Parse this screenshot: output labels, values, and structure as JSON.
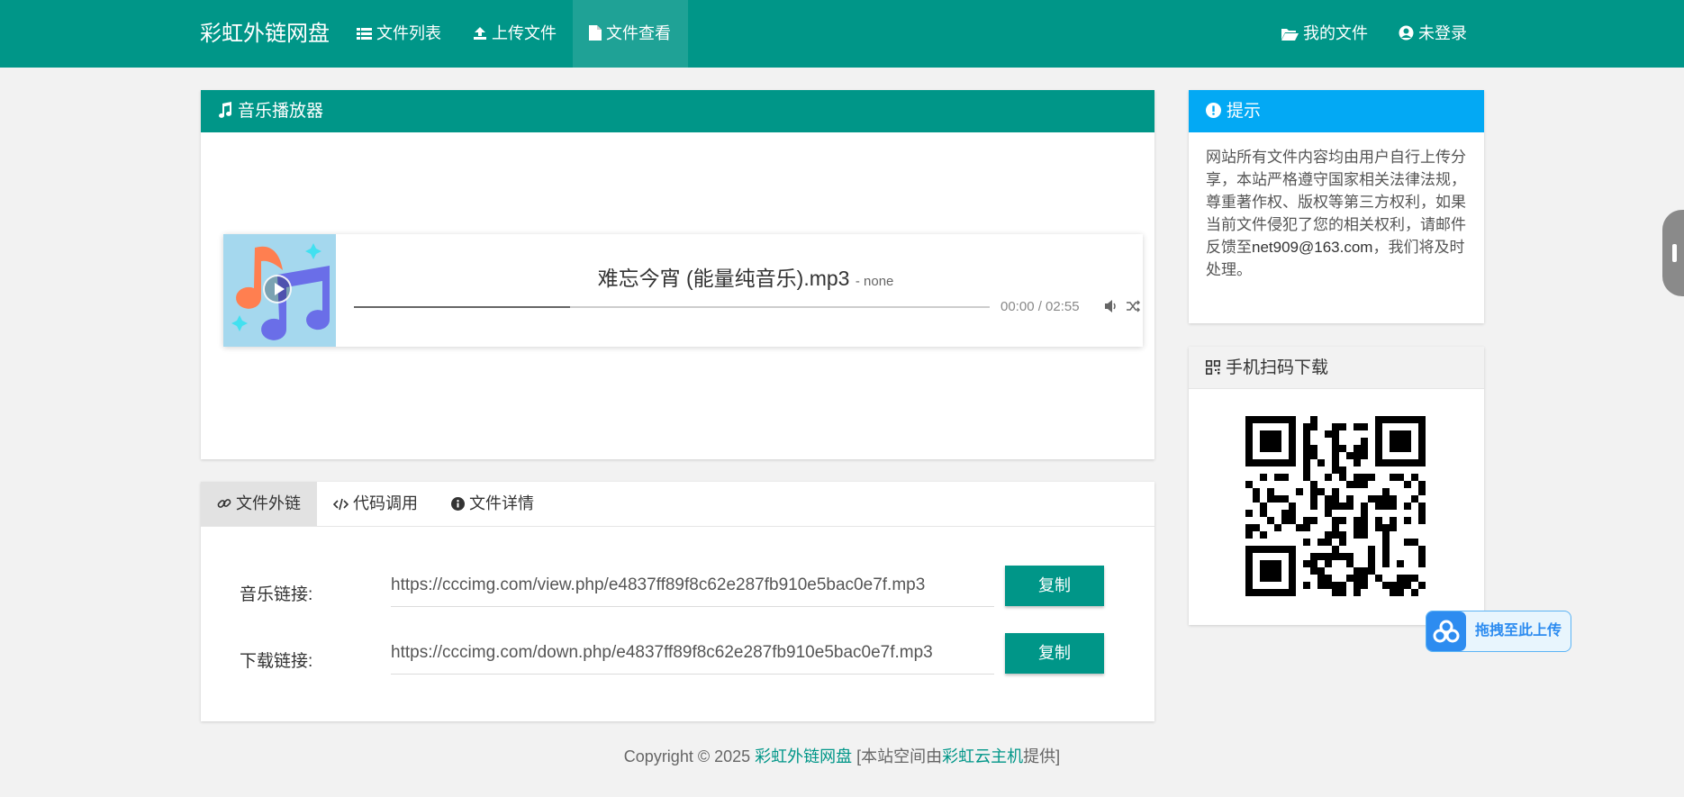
{
  "navbar": {
    "brand": "彩虹外链网盘",
    "items": [
      {
        "label": "文件列表",
        "icon": "list-icon"
      },
      {
        "label": "上传文件",
        "icon": "upload-icon"
      },
      {
        "label": "文件查看",
        "icon": "file-icon",
        "active": true
      }
    ],
    "right_items": [
      {
        "label": "我的文件",
        "icon": "folder-open-icon"
      },
      {
        "label": "未登录",
        "icon": "user-circle-icon"
      }
    ]
  },
  "player_panel": {
    "title": "音乐播放器",
    "track_title": "难忘今宵 (能量纯音乐).mp3",
    "track_artist": "- none",
    "time": "00:00 / 02:55",
    "buffered_fraction": 0.34
  },
  "links_panel": {
    "tabs": [
      {
        "label": "文件外链",
        "icon": "link-icon",
        "active": true
      },
      {
        "label": "代码调用",
        "icon": "code-icon"
      },
      {
        "label": "文件详情",
        "icon": "info-circle-icon"
      }
    ],
    "rows": [
      {
        "label": "音乐链接:",
        "value": "https://cccimg.com/view.php/e4837ff89f8c62e287fb910e5bac0e7f.mp3",
        "button": "复制"
      },
      {
        "label": "下载链接:",
        "value": "https://cccimg.com/down.php/e4837ff89f8c62e287fb910e5bac0e7f.mp3",
        "button": "复制"
      }
    ]
  },
  "tip_panel": {
    "title": "提示",
    "text": "网站所有文件内容均由用户自行上传分享，本站严格遵守国家相关法律法规，尊重著作权、版权等第三方权利，如果当前文件侵犯了您的相关权利，请邮件反馈至",
    "email": "net909@163.com",
    "text_after": "，我们将及时处理。"
  },
  "qr_panel": {
    "title": "手机扫码下载"
  },
  "footer": {
    "prefix": "Copyright © 2025 ",
    "site_link": "彩虹外链网盘",
    "middle": " [本站空间由",
    "host_link": "彩虹云主机",
    "suffix": "提供]"
  },
  "upload_float": {
    "label": "拖拽至此上传"
  },
  "colors": {
    "primary": "#009688",
    "info": "#03a9f4",
    "background": "#f2f2f2",
    "upload_accent": "#2d8cf0"
  }
}
